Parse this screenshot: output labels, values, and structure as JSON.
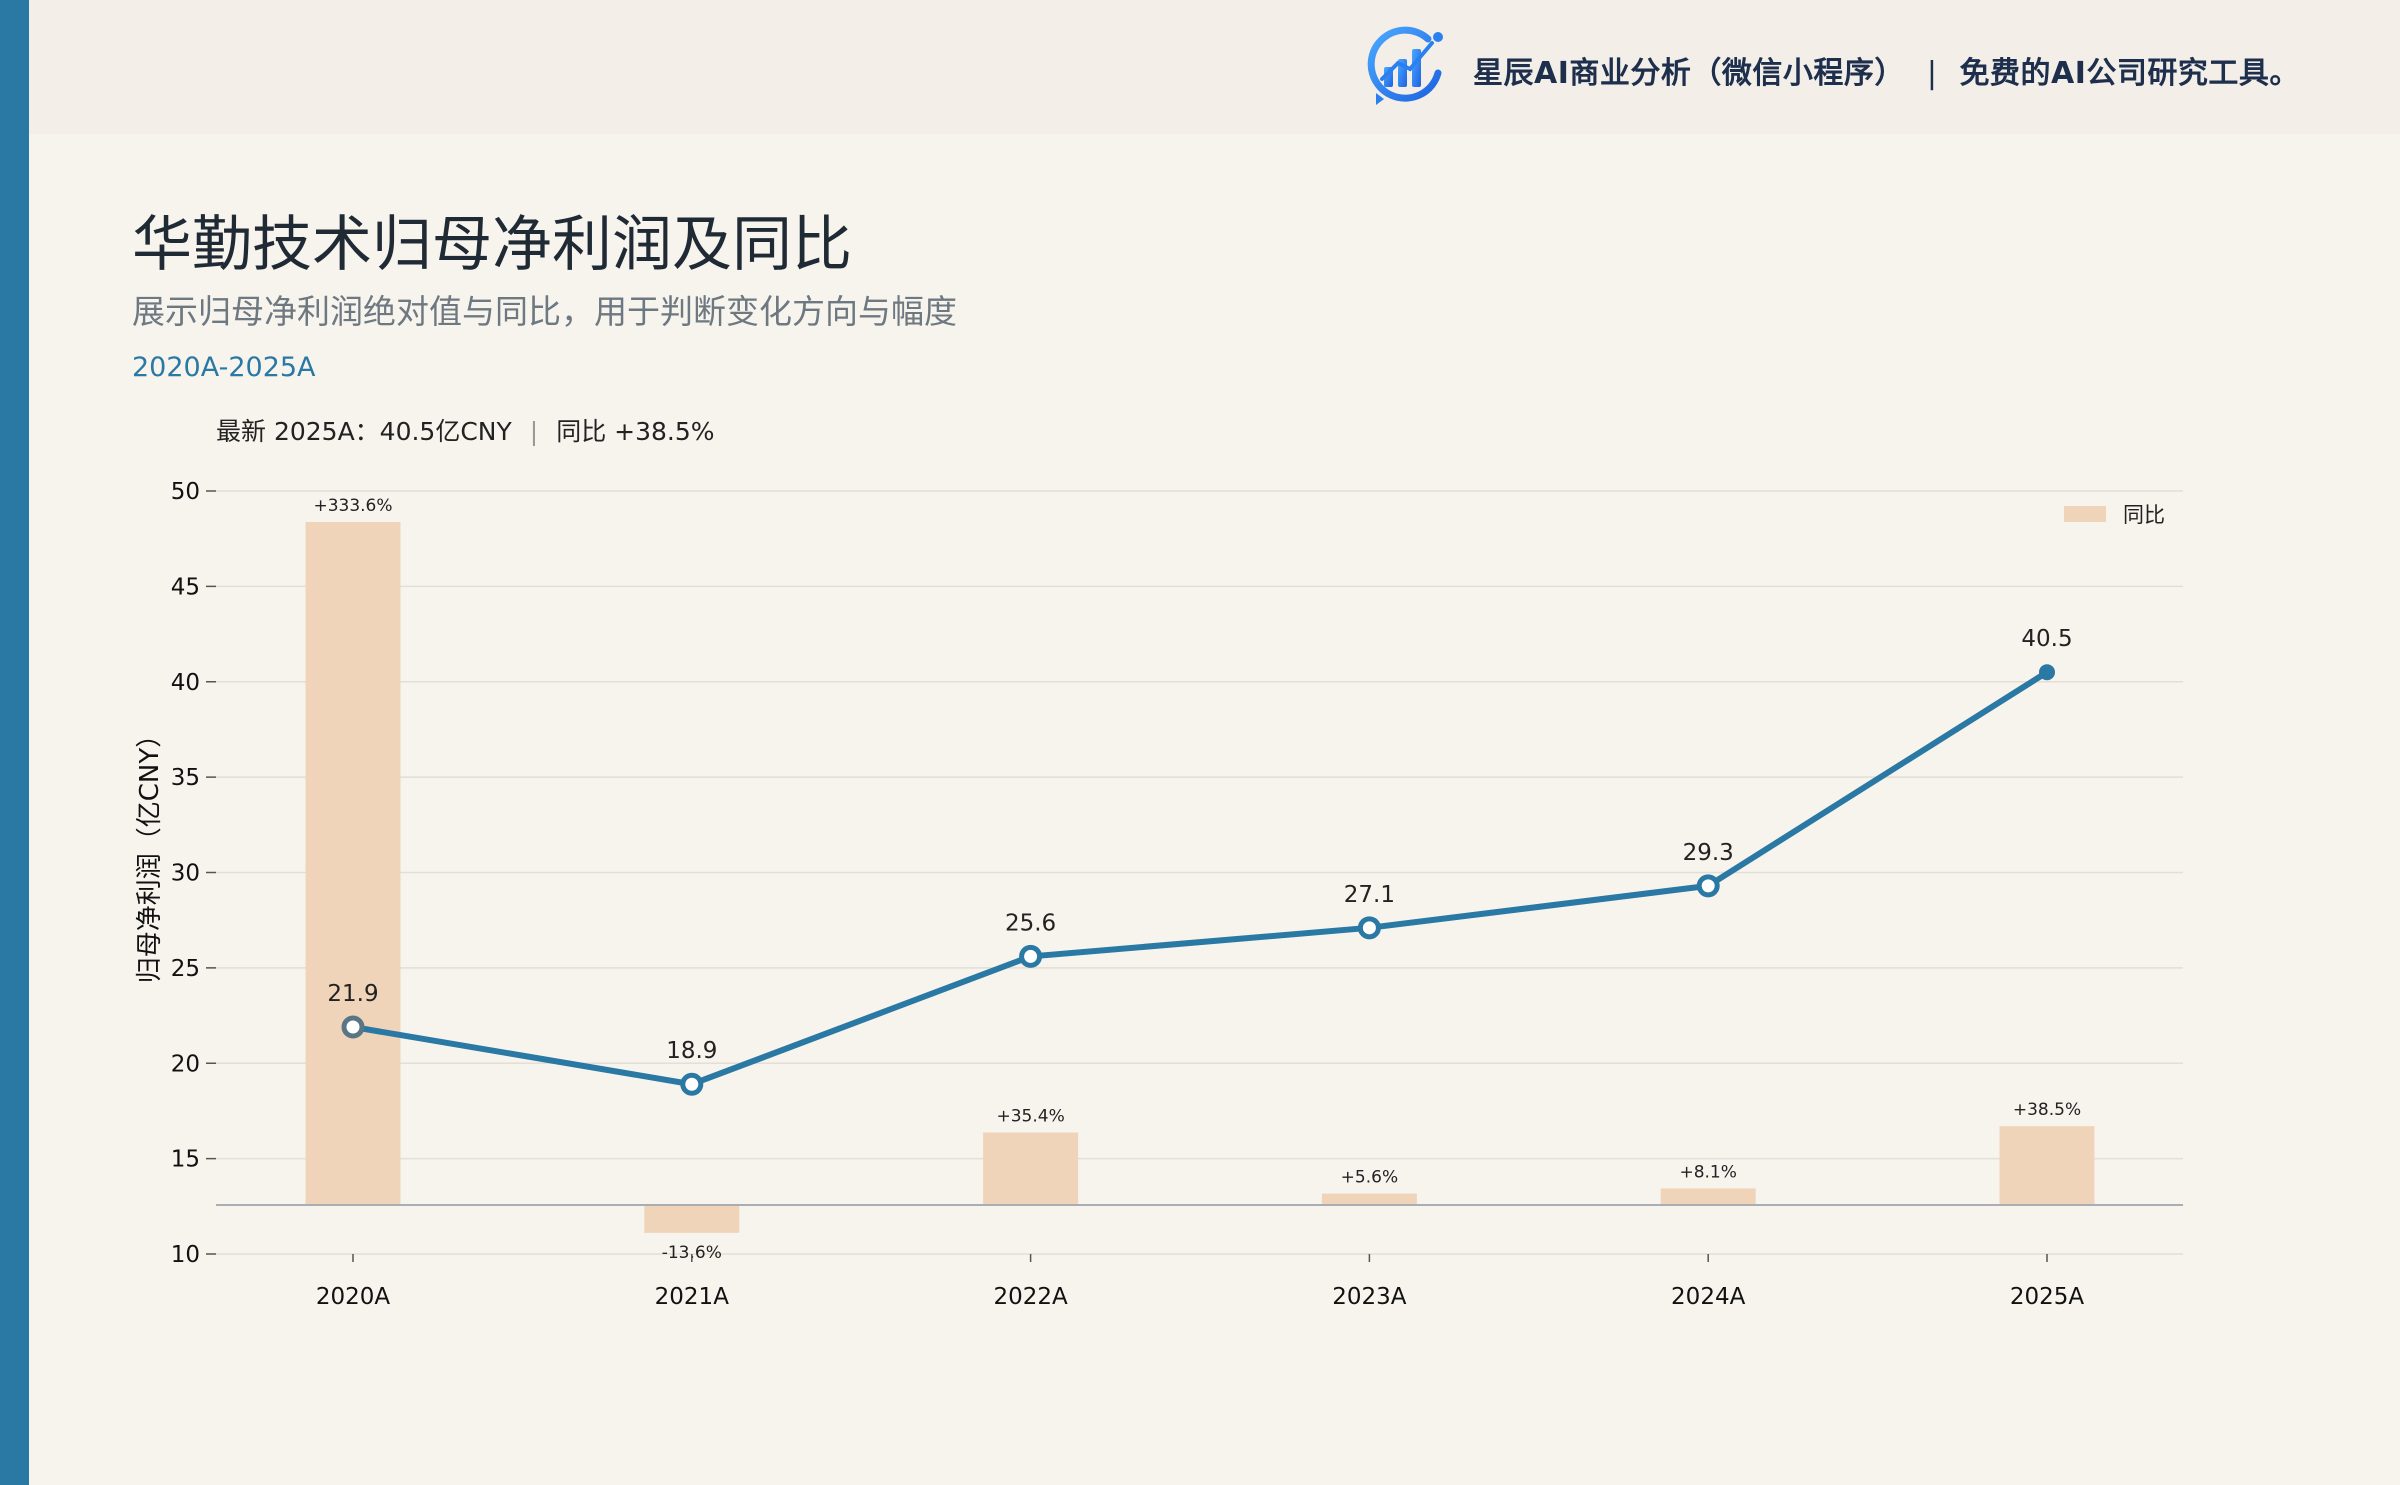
{
  "header": {
    "brand_name": "星辰AI商业分析（微信小程序）",
    "separator": "|",
    "tagline": "免费的AI公司研究工具。",
    "logo_icon": "bar-chart-logo-icon"
  },
  "page": {
    "title": "华勤技术归母净利润及同比",
    "subtitle": "展示归母净利润绝对值与同比，用于判断变化方向与幅度",
    "period": "2020A-2025A",
    "latest_text": "最新 2025A：40.5亿CNY",
    "latest_sep": "|",
    "latest_yoy": "同比 +38.5%"
  },
  "colors": {
    "accent": "#2a78a4",
    "bar": "#efd4b9",
    "line": "#2a78a4",
    "background": "#f7f4ee"
  },
  "chart_data": {
    "type": "bar+line",
    "categories": [
      "2020A",
      "2021A",
      "2022A",
      "2023A",
      "2024A",
      "2025A"
    ],
    "ylabel": "归母净利润（亿CNY）",
    "ylim": [
      10,
      50
    ],
    "yticks": [
      10,
      15,
      20,
      25,
      30,
      35,
      40,
      45,
      50
    ],
    "grid": true,
    "legend_position": "top-right",
    "series": [
      {
        "name": "同比",
        "kind": "bar",
        "values": [
          333.6,
          -13.6,
          35.4,
          5.6,
          8.1,
          38.5
        ],
        "labels": [
          "+333.6%",
          "-13.6%",
          "+35.4%",
          "+5.6%",
          "+8.1%",
          "+38.5%"
        ]
      },
      {
        "kind": "line",
        "values": [
          21.9,
          18.9,
          25.6,
          27.1,
          29.3,
          40.5
        ],
        "labels": [
          "21.9",
          "18.9",
          "25.6",
          "27.1",
          "29.3",
          "40.5"
        ]
      }
    ]
  }
}
